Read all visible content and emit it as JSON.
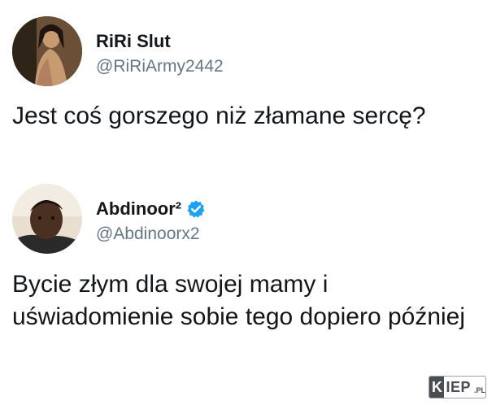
{
  "tweets": [
    {
      "display_name": "RiRi Slut",
      "handle": "@RiRiArmy2442",
      "verified": false,
      "text": "Jest coś gorszego niż złamane sercę?",
      "avatar_icon": "user-photo-woman"
    },
    {
      "display_name": "Abdinoor²",
      "handle": "@Abdinoorx2",
      "verified": true,
      "text": "Bycie złym dla swojej mamy i uświadomienie sobie tego dopiero później",
      "avatar_icon": "user-photo-man"
    }
  ],
  "watermark": {
    "first_letter": "K",
    "rest": "IEP",
    "suffix": ".PL"
  },
  "colors": {
    "text": "#14171a",
    "handle": "#657786",
    "verified_badge": "#1da1f2",
    "background": "#ffffff"
  }
}
